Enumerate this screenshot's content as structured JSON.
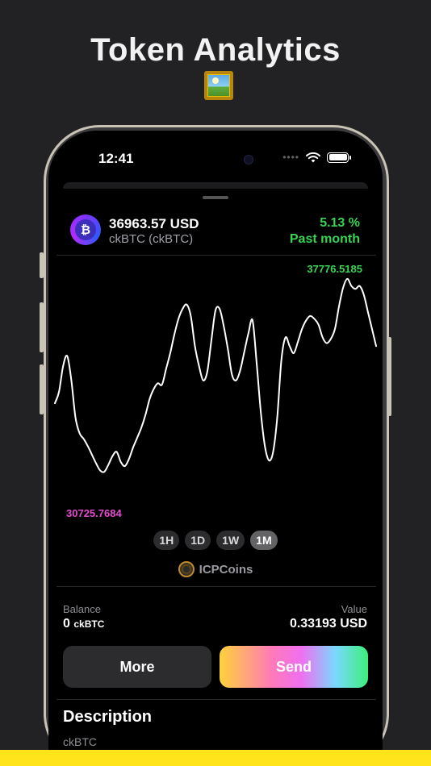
{
  "promo": {
    "title": "Token Analytics",
    "emoji_icon": "framed-picture-icon"
  },
  "status_bar": {
    "time": "12:41",
    "icons": [
      "wifi-icon",
      "battery-icon"
    ]
  },
  "token": {
    "price": "36963.57 USD",
    "name": "ckBTC (ckBTC)",
    "change_percent": "5.13 %",
    "change_period": "Past month",
    "change_color": "#39d353",
    "logo_icon": "bitcoin-icon"
  },
  "chart": {
    "max_label": "37776.5185",
    "min_label": "30725.7684",
    "max_color": "#39d353",
    "min_color": "#e64bd2",
    "ranges": [
      {
        "label": "1H",
        "active": false
      },
      {
        "label": "1D",
        "active": false
      },
      {
        "label": "1W",
        "active": false
      },
      {
        "label": "1M",
        "active": true
      }
    ],
    "provider": "ICPCoins"
  },
  "chart_data": {
    "type": "line",
    "ylim": [
      30725.7684,
      37776.5185
    ],
    "values": [
      33600,
      34000,
      34900,
      35250,
      34400,
      33100,
      32550,
      32350,
      32100,
      31800,
      31500,
      31250,
      31200,
      31450,
      31750,
      31900,
      31550,
      31400,
      31650,
      32050,
      32400,
      32750,
      33200,
      33750,
      34100,
      34300,
      34250,
      34800,
      35350,
      36000,
      36550,
      36900,
      37050,
      36650,
      35600,
      34900,
      34400,
      34700,
      35800,
      36850,
      36900,
      36300,
      35500,
      34600,
      34400,
      34750,
      35400,
      36050,
      36500,
      35000,
      33300,
      32100,
      31600,
      31900,
      33100,
      35100,
      35900,
      35600,
      35350,
      35750,
      36200,
      36500,
      36650,
      36550,
      36350,
      35900,
      35700,
      35850,
      36200,
      37000,
      37650,
      37950,
      37700,
      37600,
      37700,
      37400,
      36800,
      36200,
      35600
    ]
  },
  "balance": {
    "label": "Balance",
    "amount": "0",
    "unit": "ckBTC"
  },
  "value": {
    "label": "Value",
    "amount": "0.33193 USD"
  },
  "actions": {
    "more_label": "More",
    "send_label": "Send"
  },
  "description": {
    "title": "Description",
    "text": "ckBTC"
  }
}
